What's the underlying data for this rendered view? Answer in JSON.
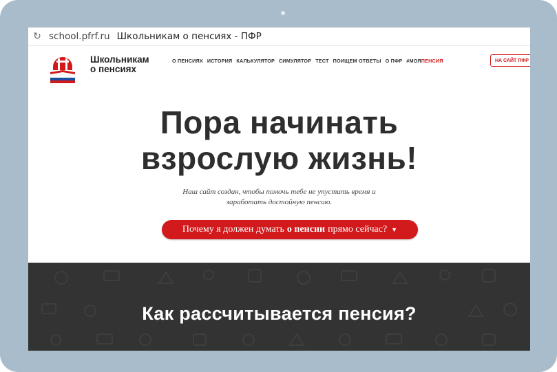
{
  "browser": {
    "url": "school.pfrf.ru",
    "page_title": "Школьникам о пенсиях - ПФР"
  },
  "site": {
    "logo_line1": "Школьникам",
    "logo_line2": "о пенсиях",
    "nav": [
      "О ПЕНСИЯХ",
      "ИСТОРИЯ",
      "КАЛЬКУЛЯТОР",
      "СИМУЛЯТОР",
      "ТЕСТ",
      "ПОИЩЕМ ОТВЕТЫ",
      "О ПФР"
    ],
    "hashtag_prefix": "#МОЯ",
    "hashtag_red": "ПЕНСИЯ",
    "external_button": "НА САЙТ ПФР"
  },
  "hero": {
    "title_line1": "Пора начинать",
    "title_line2": "взрослую жизнь!",
    "subtitle_line1": "Наш сайт создан, чтобы помочь тебе не упустить время и",
    "subtitle_line2": "заработать достойную пенсию.",
    "cta_before": "Почему я должен думать",
    "cta_bold": "о пенсии",
    "cta_after": "прямо сейчас?",
    "cta_arrow": "▼"
  },
  "section": {
    "title": "Как рассчитывается пенсия?"
  },
  "colors": {
    "accent": "#d2191c",
    "dark_section": "#333333",
    "device_frame": "#a8bccb"
  }
}
